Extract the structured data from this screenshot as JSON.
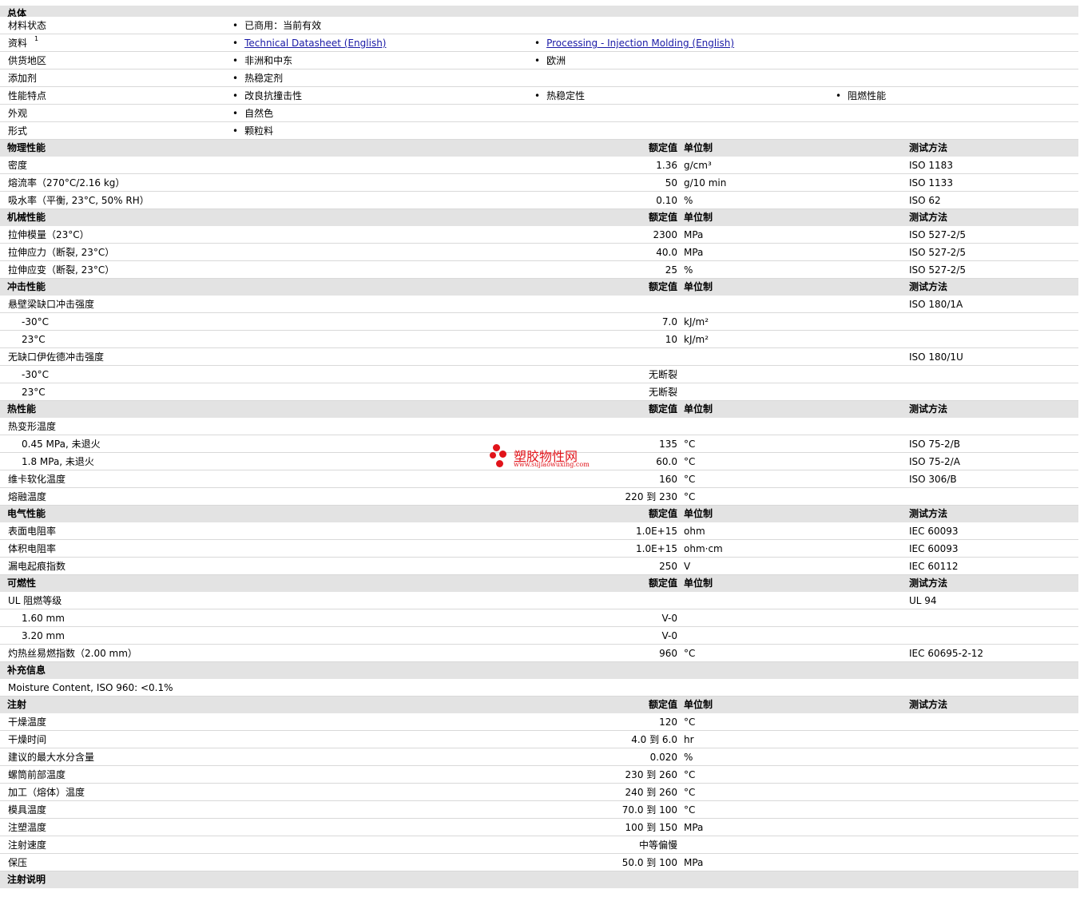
{
  "general": {
    "title": "总体",
    "rows": [
      {
        "label": "材料状态",
        "items": [
          "已商用：当前有效"
        ]
      },
      {
        "label": "资料",
        "sup": "1",
        "items": [
          "Technical Datasheet (English)",
          "Processing - Injection Molding (English)"
        ],
        "links": true
      },
      {
        "label": "供货地区",
        "items": [
          "非洲和中东",
          "欧洲"
        ]
      },
      {
        "label": "添加剂",
        "items": [
          "热稳定剂"
        ]
      },
      {
        "label": "性能特点",
        "items": [
          "改良抗撞击性",
          "热稳定性",
          "阻燃性能"
        ]
      },
      {
        "label": "外观",
        "items": [
          "自然色"
        ]
      },
      {
        "label": "形式",
        "items": [
          "颗粒料"
        ]
      }
    ]
  },
  "col_headers": {
    "value": "额定值",
    "unit": "单位制",
    "test": "测试方法"
  },
  "sections": [
    {
      "title": "物理性能",
      "headers": true,
      "rows": [
        {
          "name": "密度",
          "value": "1.36",
          "unit": "g/cm³",
          "test": "ISO 1183"
        },
        {
          "name": "熔流率（270°C/2.16 kg）",
          "value": "50",
          "unit": "g/10 min",
          "test": "ISO 1133"
        },
        {
          "name": "吸水率（平衡, 23°C, 50% RH）",
          "value": "0.10",
          "unit": "%",
          "test": "ISO 62"
        }
      ]
    },
    {
      "title": "机械性能",
      "headers": true,
      "rows": [
        {
          "name": "拉伸模量（23°C）",
          "value": "2300",
          "unit": "MPa",
          "test": "ISO 527-2/5"
        },
        {
          "name": "拉伸应力（断裂, 23°C）",
          "value": "40.0",
          "unit": "MPa",
          "test": "ISO 527-2/5"
        },
        {
          "name": "拉伸应变（断裂, 23°C）",
          "value": "25",
          "unit": "%",
          "test": "ISO 527-2/5"
        }
      ]
    },
    {
      "title": "冲击性能",
      "headers": true,
      "rows": [
        {
          "name": "悬壁梁缺口冲击强度",
          "value": "",
          "unit": "",
          "test": "ISO 180/1A"
        },
        {
          "name": "-30°C",
          "indent": true,
          "value": "7.0",
          "unit": "kJ/m²",
          "test": ""
        },
        {
          "name": "23°C",
          "indent": true,
          "value": "10",
          "unit": "kJ/m²",
          "test": ""
        },
        {
          "name": "无缺口伊佐德冲击强度",
          "value": "",
          "unit": "",
          "test": "ISO 180/1U"
        },
        {
          "name": "-30°C",
          "indent": true,
          "value": "无断裂",
          "unit": "",
          "test": ""
        },
        {
          "name": "23°C",
          "indent": true,
          "value": "无断裂",
          "unit": "",
          "test": ""
        }
      ]
    },
    {
      "title": "热性能",
      "headers": true,
      "rows": [
        {
          "name": "热变形温度",
          "value": "",
          "unit": "",
          "test": ""
        },
        {
          "name": "0.45 MPa, 未退火",
          "indent": true,
          "value": "135",
          "unit": "°C",
          "test": "ISO 75-2/B"
        },
        {
          "name": "1.8 MPa, 未退火",
          "indent": true,
          "value": "60.0",
          "unit": "°C",
          "test": "ISO 75-2/A"
        },
        {
          "name": "维卡软化温度",
          "value": "160",
          "unit": "°C",
          "test": "ISO 306/B"
        },
        {
          "name": "熔融温度",
          "value": "220 到  230",
          "unit": "°C",
          "test": ""
        }
      ]
    },
    {
      "title": "电气性能",
      "headers": true,
      "rows": [
        {
          "name": "表面电阻率",
          "value": "1.0E+15",
          "unit": "ohm",
          "test": "IEC 60093"
        },
        {
          "name": "体积电阻率",
          "value": "1.0E+15",
          "unit": "ohm·cm",
          "test": "IEC 60093"
        },
        {
          "name": "漏电起痕指数",
          "value": "250",
          "unit": "V",
          "test": "IEC 60112"
        }
      ]
    },
    {
      "title": "可燃性",
      "headers": true,
      "rows": [
        {
          "name": "UL 阻燃等级",
          "value": "",
          "unit": "",
          "test": "UL 94"
        },
        {
          "name": "1.60 mm",
          "indent": true,
          "value": "V-0",
          "unit": "",
          "test": ""
        },
        {
          "name": "3.20 mm",
          "indent": true,
          "value": "V-0",
          "unit": "",
          "test": ""
        },
        {
          "name": "灼热丝易燃指数（2.00 mm）",
          "value": "960",
          "unit": "°C",
          "test": "IEC 60695-2-12"
        }
      ]
    },
    {
      "title": "补充信息",
      "headers": false,
      "rows": [
        {
          "name": "Moisture Content, ISO 960: <0.1%",
          "value": "",
          "unit": "",
          "test": ""
        }
      ]
    },
    {
      "title": "注射",
      "headers": true,
      "rows": [
        {
          "name": "干燥温度",
          "value": "120",
          "unit": "°C",
          "test": ""
        },
        {
          "name": "干燥时间",
          "value": "4.0 到  6.0",
          "unit": "hr",
          "test": ""
        },
        {
          "name": "建议的最大水分含量",
          "value": "0.020",
          "unit": "%",
          "test": ""
        },
        {
          "name": "螺筒前部温度",
          "value": "230 到  260",
          "unit": "°C",
          "test": ""
        },
        {
          "name": "加工（熔体）温度",
          "value": "240 到  260",
          "unit": "°C",
          "test": ""
        },
        {
          "name": "模具温度",
          "value": "70.0 到  100",
          "unit": "°C",
          "test": ""
        },
        {
          "name": "注塑温度",
          "value": "100 到  150",
          "unit": "MPa",
          "test": ""
        },
        {
          "name": "注射速度",
          "value": "中等偏慢",
          "unit": "",
          "test": ""
        },
        {
          "name": "保压",
          "value": "50.0 到  100",
          "unit": "MPa",
          "test": ""
        }
      ]
    },
    {
      "title": "注射说明",
      "headers": false,
      "rows": []
    }
  ],
  "watermark": {
    "name": "塑胶物性网",
    "url": "www.sujiaowuxing.com"
  }
}
